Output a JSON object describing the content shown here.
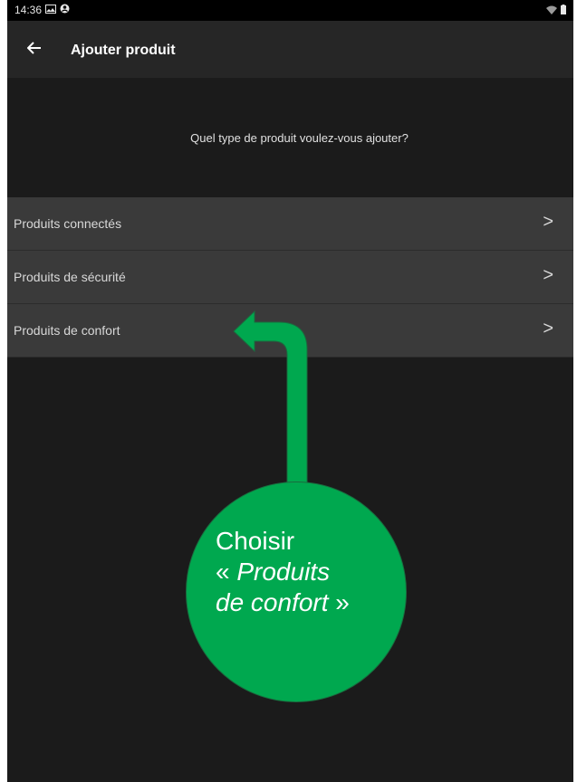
{
  "status_bar": {
    "time": "14:36",
    "left_icons": [
      "image-icon",
      "account-circle-icon"
    ],
    "right_icons": [
      "wifi-icon",
      "battery-icon"
    ]
  },
  "app_bar": {
    "back_icon": "arrow-left-icon",
    "title": "Ajouter produit"
  },
  "prompt": "Quel type de produit voulez-vous ajouter?",
  "menu": {
    "items": [
      {
        "label": "Produits connectés",
        "chevron": ">"
      },
      {
        "label": "Produits de sécurité",
        "chevron": ">"
      },
      {
        "label": "Produits de confort",
        "chevron": ">"
      }
    ]
  },
  "callout": {
    "line1": "Choisir",
    "line2_open": "« ",
    "line2_italic": "Produits",
    "line3_italic": "de confort",
    "line3_close": " »",
    "color": "#00a84f"
  },
  "colors": {
    "background": "#1b1b1b",
    "app_bar": "#262626",
    "menu_item": "#3a3a3a",
    "accent_green": "#00a84f"
  }
}
